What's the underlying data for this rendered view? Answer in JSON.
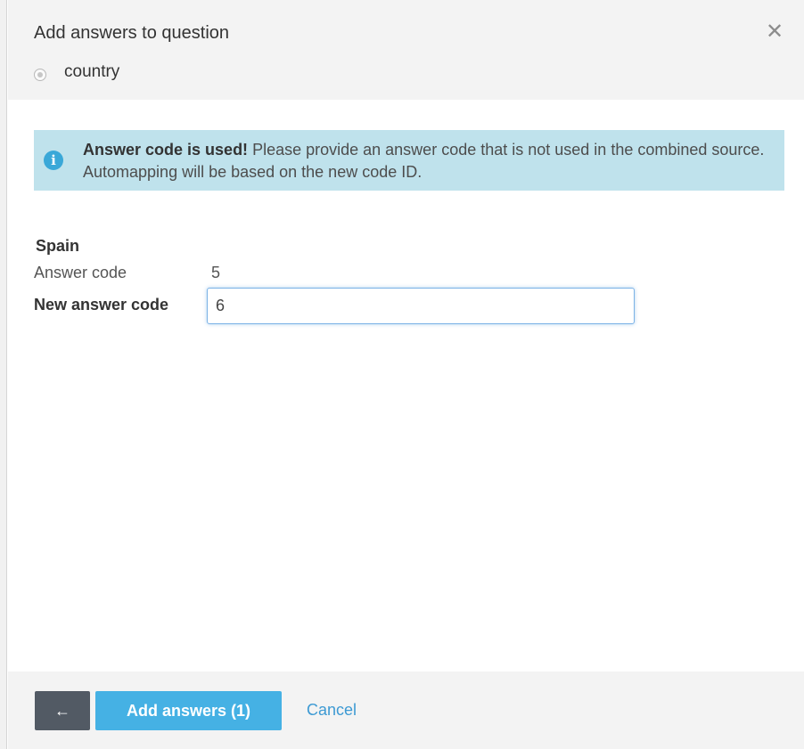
{
  "dialog": {
    "title": "Add answers to question",
    "close_glyph": "✕",
    "question": "country"
  },
  "alert": {
    "icon": "info-icon",
    "icon_glyph": "i",
    "strong": "Answer code is used!",
    "message": " Please provide an answer code that is not used in the combined source. Automapping will be based on the new code ID."
  },
  "answer": {
    "title": "Spain",
    "code_label": "Answer code",
    "code_value": "5",
    "new_code_label": "New answer code",
    "new_code_value": "6"
  },
  "footer": {
    "back_glyph": "←",
    "add_label": "Add answers (1)",
    "cancel_label": "Cancel"
  },
  "colors": {
    "alert_bg": "#bfe2ec",
    "info_icon": "#3aa8d8",
    "primary_button": "#45b1e4",
    "back_button": "#525a64",
    "link": "#3d9ad3"
  }
}
